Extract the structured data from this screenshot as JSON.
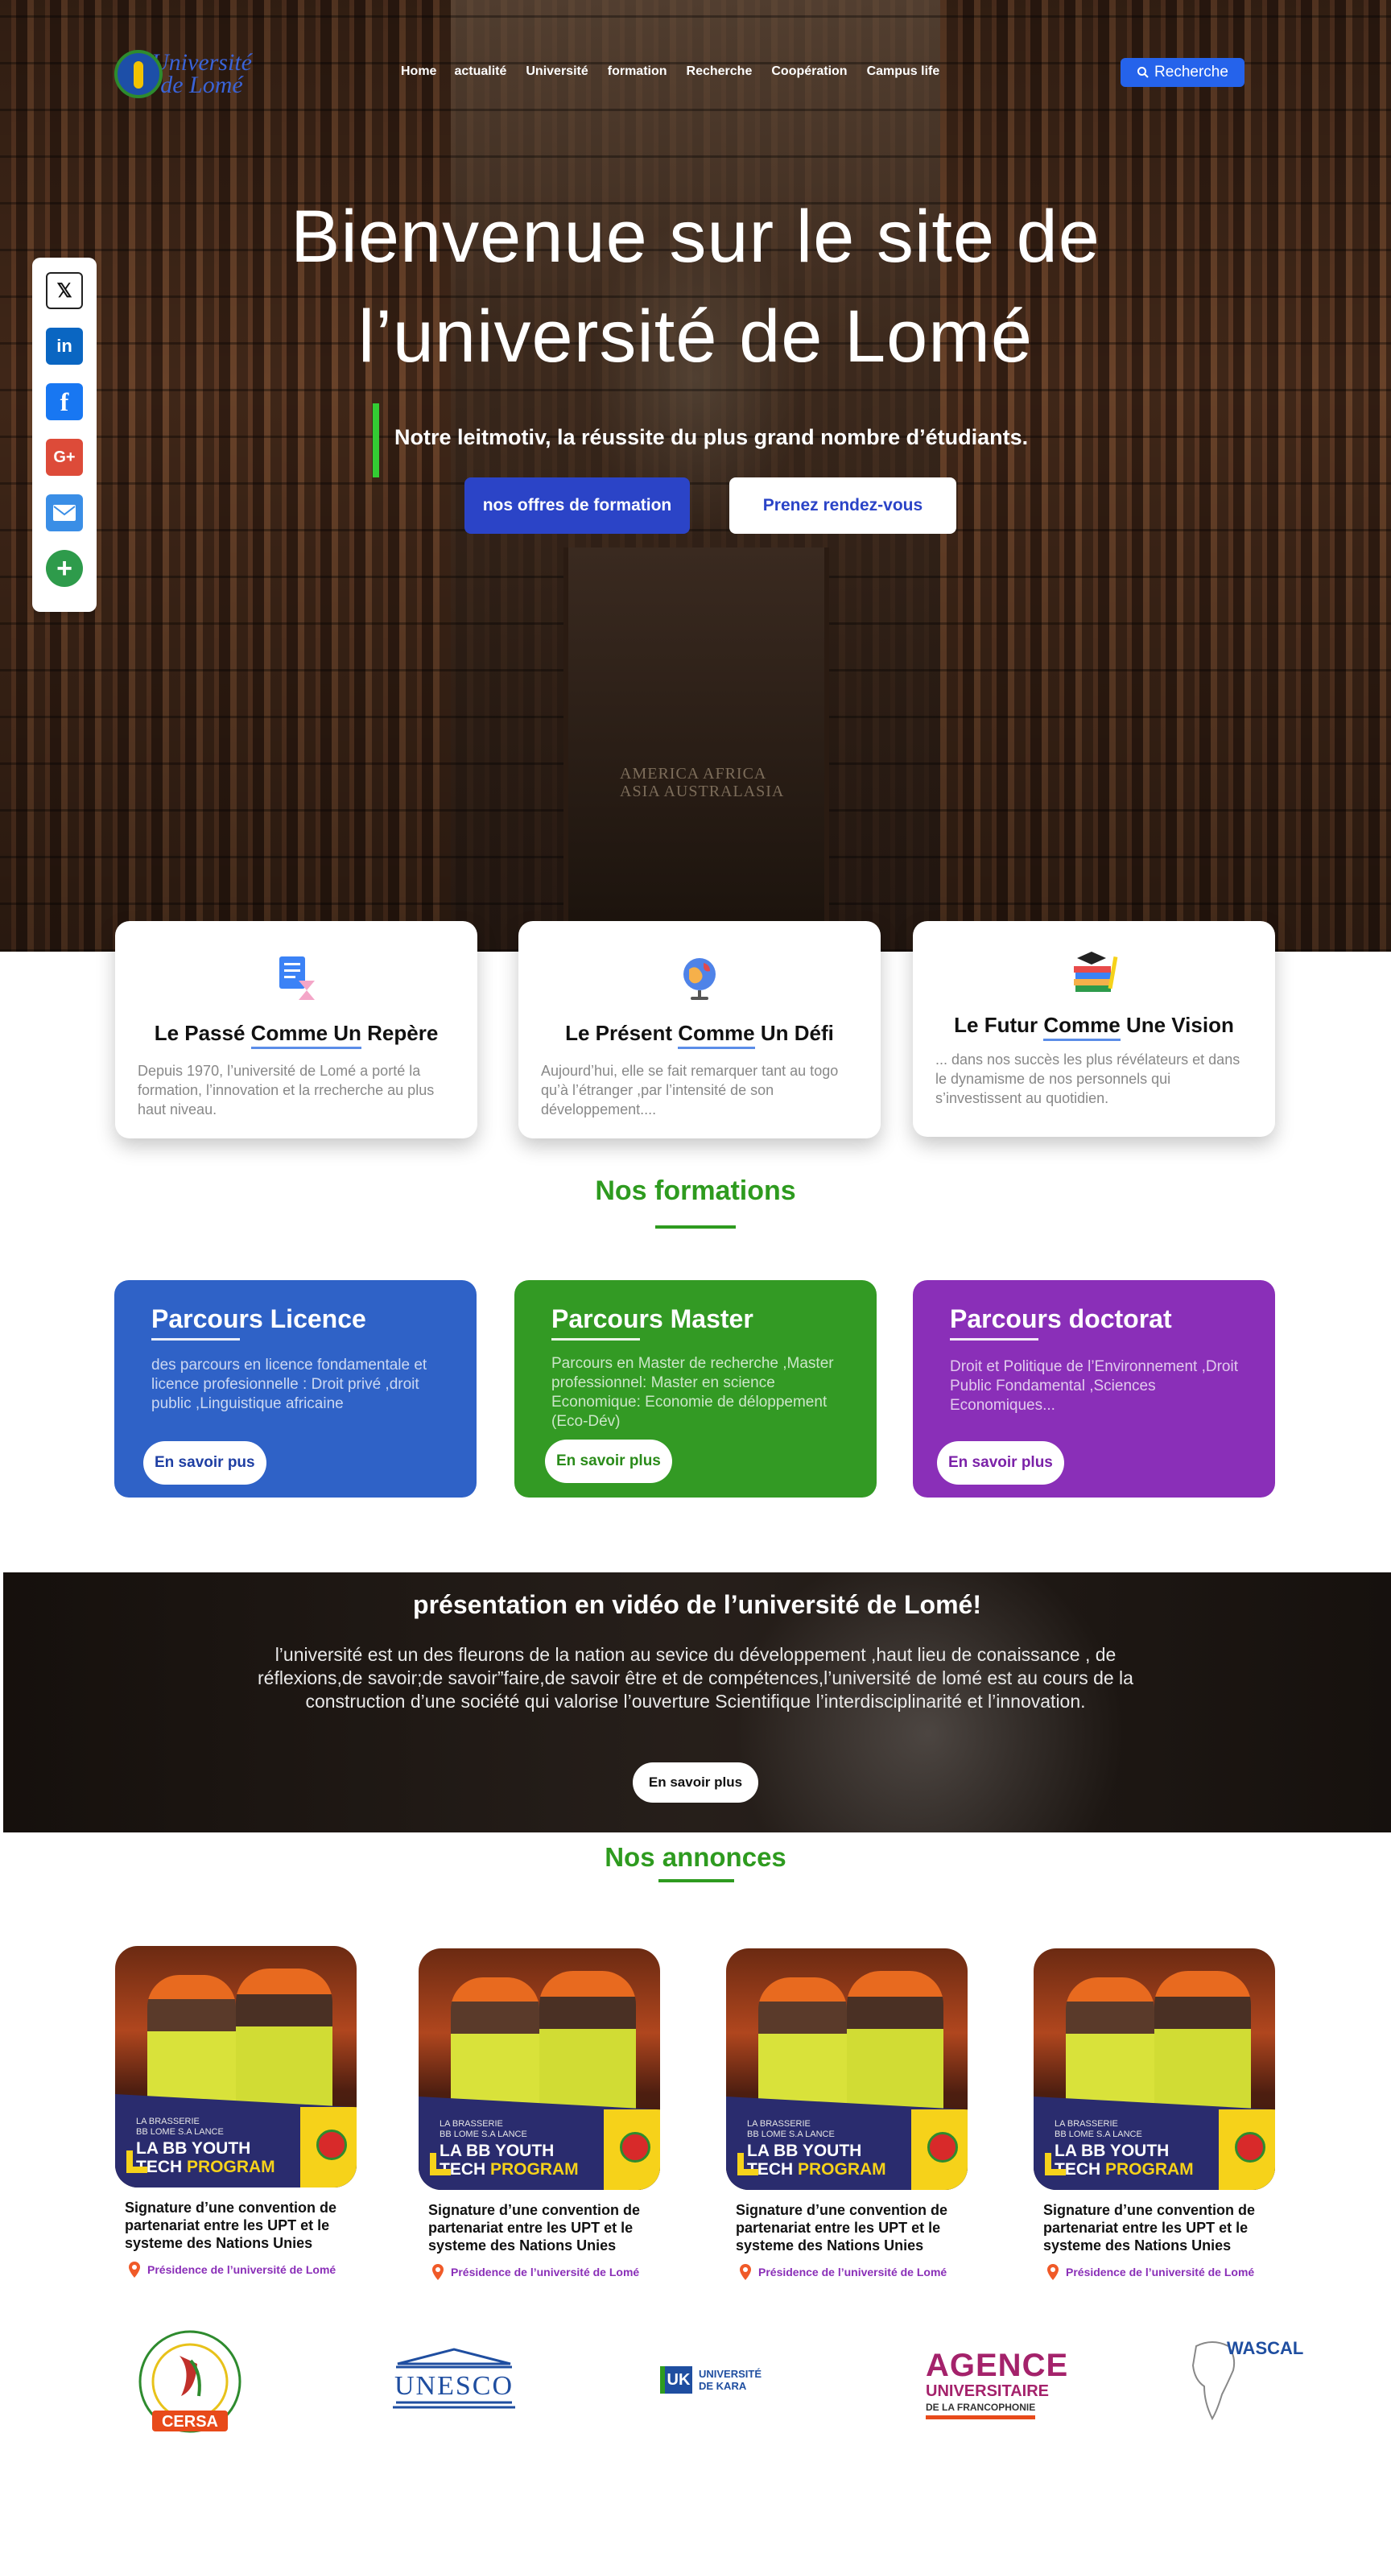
{
  "header": {
    "logo_text_line1": "Université",
    "logo_text_line2": "de Lomé",
    "nav": [
      "Home",
      "actualité",
      "Université",
      "formation",
      "Recherche",
      "Coopération",
      "Campus life"
    ],
    "search_label": "Recherche"
  },
  "hero": {
    "title_line1": "Bienvenue sur le site de",
    "title_line2": "l’université de Lomé",
    "motto": "Notre leitmotiv, la réussite du plus grand nombre d’étudiants.",
    "btn_primary": "nos offres de formation",
    "btn_secondary": "Prenez rendez-vous",
    "background_text_1": "AMERICA     AFRICA",
    "background_text_2": "ASIA     AUSTRALASIA"
  },
  "social": {
    "icons": [
      "x-icon",
      "linkedin-icon",
      "facebook-icon",
      "google-plus-icon",
      "email-icon",
      "share-plus-icon"
    ]
  },
  "features": [
    {
      "title_pre": "Le Passé ",
      "title_ul": "Comme Un",
      "title_post": " Repère",
      "text": "Depuis 1970, l’université de  Lomé a porté la formation, l’innovation  et la rrecherche au plus haut niveau.",
      "icon": "document-hourglass-icon"
    },
    {
      "title_pre": "Le Présent ",
      "title_ul": "Comme",
      "title_post": "  Un Défi",
      "text": "Aujourd’hui, elle se fait remarquer tant au togo qu’à l’étranger ,par l’intensité de son développement....",
      "icon": "globe-icon"
    },
    {
      "title_pre": "Le Futur ",
      "title_ul": "Comme",
      "title_post": " Une Vision",
      "text": "... dans nos succès les plus révélateurs  et dans le dynamisme de nos personnels qui s’investissent au quotidien.",
      "icon": "books-graduation-icon"
    }
  ],
  "formations": {
    "title": "Nos formations",
    "cards": [
      {
        "title": "Parcours Licence",
        "text": "des parcours en licence fondamentale  et licence profesionnelle : Droit privé ,droit public ,Linguistique africaine",
        "button": "En savoir pus"
      },
      {
        "title": "Parcours Master",
        "text": "Parcours en Master de recherche ,Master professionnel: Master en science Economique: Economie de déloppement (Eco-Dév)",
        "button": "En savoir plus"
      },
      {
        "title": "Parcours doctorat",
        "text": "Droit et Politique de l’Environnement ,Droit Public Fondamental ,Sciences Economiques...",
        "button": "En savoir plus"
      }
    ]
  },
  "video": {
    "title": "présentation en vidéo de l’université de Lomé!",
    "text": "l’université est un des fleurons de la nation au sevice du développement ,haut lieu de conaissance , de réflexions,de savoir;de savoir”faire,de savoir être et de compétences,l’université de lomé est au cours de  la construction d’une société qui valorise l’ouverture Scientifique l’interdisciplinarité et l’innovation.",
    "button": "En savoir plus"
  },
  "announcements": {
    "title": "Nos annonces",
    "items": [
      {
        "img_small": "LA BRASSERIE\nBB LOME S.A LANCE",
        "img_big_1": "LA BB YOUTH",
        "img_big_2a": "TECH ",
        "img_big_2b": "PROGRAM",
        "title": "Signature d’une convention de partenariat entre les UPT et le systeme des Nations Unies",
        "location": "Présidence de l’université de Lomé"
      },
      {
        "img_small": "LA BRASSERIE\nBB LOME S.A LANCE",
        "img_big_1": "LA BB YOUTH",
        "img_big_2a": "TECH ",
        "img_big_2b": "PROGRAM",
        "title": "Signature d’une convention de partenariat entre les UPT et le systeme des Nations Unies",
        "location": "Présidence de l’université de Lomé"
      },
      {
        "img_small": "LA BRASSERIE\nBB LOME S.A LANCE",
        "img_big_1": "LA BB YOUTH",
        "img_big_2a": "TECH ",
        "img_big_2b": "PROGRAM",
        "title": "Signature d’une convention de partenariat entre les UPT et le systeme des Nations Unies",
        "location": "Présidence de l’université de Lomé"
      },
      {
        "img_small": "LA BRASSERIE\nBB LOME S.A LANCE",
        "img_big_1": "LA BB YOUTH",
        "img_big_2a": "TECH ",
        "img_big_2b": "PROGRAM",
        "title": "Signature d’une convention de partenariat entre les UPT et le systeme des Nations Unies",
        "location": "Présidence de l’université de Lomé"
      }
    ]
  },
  "partners": {
    "cersa": "CERSA",
    "unesco": "UNESCO",
    "kara_badge": "UK",
    "kara_text_1": "UNIVERSITÉ",
    "kara_text_2": "DE KARA",
    "auf_1": "AGENCE",
    "auf_2": "UNIVERSITAIRE",
    "auf_3": "DE LA FRANCOPHONIE",
    "wascal": "WASCAL"
  },
  "colors": {
    "primary_blue": "#2b44c7",
    "green": "#2e9b1f",
    "purple": "#8a2fb8",
    "licence_blue": "#2f62c7"
  }
}
